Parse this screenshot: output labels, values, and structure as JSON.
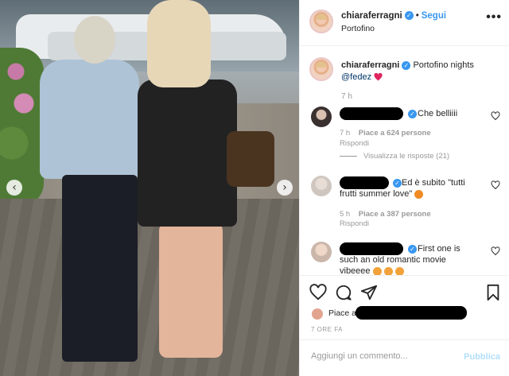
{
  "header": {
    "username": "chiaraferragni",
    "separator": "•",
    "follow_label": "Segui",
    "location": "Portofino",
    "more": "•••"
  },
  "caption": {
    "username": "chiaraferragni",
    "text": "Portofino nights",
    "mention": "@fedez",
    "time": "7 h"
  },
  "comments": [
    {
      "text": "Che belliiii",
      "time": "7 h",
      "likes": "Piace a 624 persone",
      "reply": "Rispondi",
      "view_replies": "Visualizza le risposte (21)"
    },
    {
      "text": "Ed è subito \"tutti",
      "text2": "frutti summer love\"",
      "time": "5 h",
      "likes": "Piace a 387 persone",
      "reply": "Rispondi"
    },
    {
      "text": "First one is",
      "text2": "such an old romantic movie",
      "text3": "vibeeee"
    }
  ],
  "likes": {
    "prefix": "Piace a",
    "age": "7 ORE FA"
  },
  "comment_box": {
    "placeholder": "Aggiungi un commento...",
    "publish_label": "Pubblica"
  },
  "colors": {
    "accent": "#3897f0",
    "publish_disabled": "#b2dffc",
    "heart_red": "#ed4956"
  }
}
